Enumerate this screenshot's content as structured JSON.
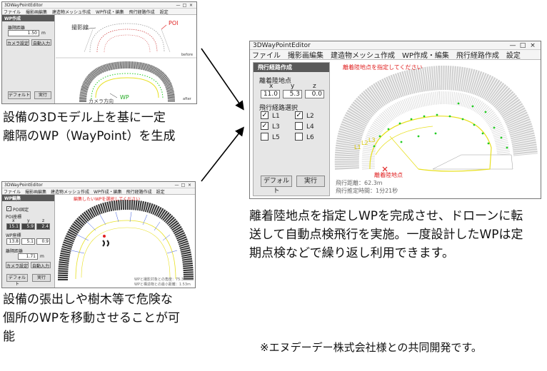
{
  "window1": {
    "title": "3DWayPointEditor",
    "controls": [
      "—",
      "□",
      "×"
    ],
    "menu": [
      "ファイル",
      "撮影画編集",
      "建造物メッシュ作成",
      "WP作成・編集",
      "飛行経路作成",
      "設定"
    ],
    "panel_title": "WP作成",
    "distance_label": "離隔距離",
    "distance_value": "1.50",
    "distance_unit": "m",
    "btn_camera": "カメラ設定",
    "btn_auto": "自動入力",
    "btn_default": "デフォルト",
    "btn_run": "実行",
    "label_shot": "撮影線",
    "label_poi": "POI",
    "label_before": "before",
    "label_wp": "WP",
    "label_camera": "カメラ方向",
    "label_after": "after"
  },
  "window2": {
    "title": "3DWayPointEditor",
    "controls": [
      "—",
      "□",
      "×"
    ],
    "menu": [
      "ファイル",
      "撮影画編集",
      "建造物メッシュ作成",
      "WP作成・編集",
      "飛行経路作成",
      "設定"
    ],
    "panel_title": "WP編集",
    "poi_fixed": "POI固定",
    "poi_coord": "POI座標",
    "axes": [
      "x",
      "y",
      "z"
    ],
    "poi_values": [
      "15.1",
      "5.9",
      "2.4"
    ],
    "wp_coord": "WP座標",
    "wp_values": [
      "13.8",
      "5.1",
      "0.9"
    ],
    "distance_label": "離隔距離",
    "distance_value": "1.71",
    "distance_unit": "m",
    "btn_camera": "カメラ設定",
    "btn_auto": "自動入力",
    "btn_default": "デフォルト",
    "btn_run": "実行",
    "notice": "編集したいWPを選択してください",
    "info1": "WPと撮影対象との角度：75.3°",
    "info2": "WPと構造物との最小距離：1.53m"
  },
  "window3": {
    "title": "3DWayPointEditor",
    "controls": [
      "—",
      "□",
      "×"
    ],
    "menu": [
      "ファイル",
      "撮影画編集",
      "建造物メッシュ作成",
      "WP作成・編集",
      "飛行経路作成",
      "設定"
    ],
    "panel_title": "飛行経路作成",
    "landing_label": "離着陸地点",
    "axes": [
      "x",
      "y",
      "z"
    ],
    "landing_values": [
      "11.0",
      "5.3",
      "0.0"
    ],
    "route_select": "飛行経路選択",
    "routes": [
      {
        "label": "L1",
        "checked": true
      },
      {
        "label": "L2",
        "checked": true
      },
      {
        "label": "L3",
        "checked": true
      },
      {
        "label": "L4",
        "checked": false
      },
      {
        "label": "L5",
        "checked": false
      },
      {
        "label": "L6",
        "checked": false
      }
    ],
    "btn_default": "デフォルト",
    "btn_run": "実行",
    "notice": "離着陸地点を指定してください",
    "tags": [
      "L1",
      "L2",
      "L3"
    ],
    "landing_tag": "離着陸地点",
    "flight_distance": "飛行距離：62.3m",
    "flight_time": "飛行推定時間：1分21秒"
  },
  "captions": {
    "c1_line1": "設備の3Dモデル上を基に一定",
    "c1_line2": "離隔のWP（WayPoint）を生成",
    "c2_line1": "設備の張出しや樹木等で危険な",
    "c2_line2": "個所のWPを移動させることが可",
    "c2_line3": "能",
    "c3_line1": "離着陸地点を指定しWPを完成させ、ドローンに転",
    "c3_line2": "送して自動点検飛行を実施。一度設計したWPは定",
    "c3_line3": "期点検などで繰り返し利用できます。",
    "footnote": "※エヌデーデー株式会社様との共同開発です。"
  },
  "colors": {
    "panel_header": "#595959",
    "accent_red": "#e02020",
    "route_yellow": "#e8e020",
    "wp_green": "#22cc22",
    "line_blue": "#3b5bdb"
  }
}
